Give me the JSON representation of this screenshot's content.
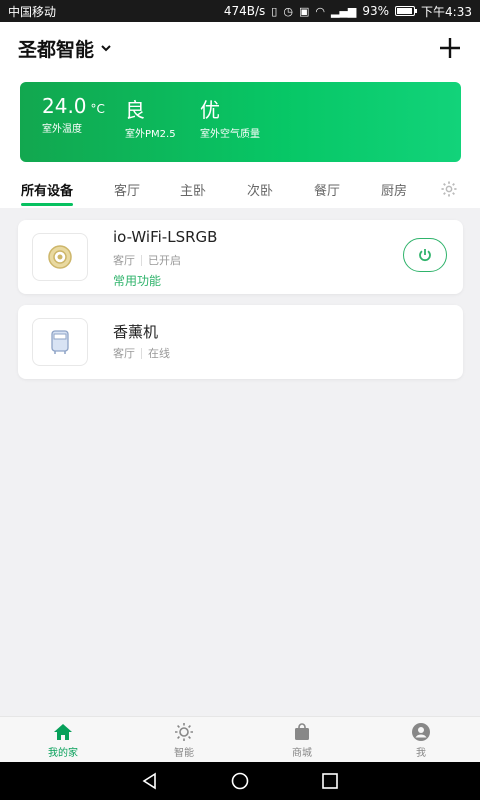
{
  "status_bar": {
    "carrier": "中国移动",
    "speed": "474B/s",
    "battery": "93%",
    "battery_level": 0.93,
    "time": "下午4:33"
  },
  "header": {
    "home_name": "圣都智能",
    "icons": {
      "dropdown": "chevron-down-icon",
      "add": "plus-icon"
    }
  },
  "weather": {
    "temperature": {
      "value": "24.0",
      "unit": "°C",
      "label": "室外温度"
    },
    "pm25": {
      "value": "良",
      "label": "室外PM2.5"
    },
    "air_quality": {
      "value": "优",
      "label": "室外空气质量"
    },
    "colors": {
      "start": "#12a74f",
      "end": "#12d37a"
    }
  },
  "tabs": {
    "items": [
      {
        "label": "所有设备",
        "active": true
      },
      {
        "label": "客厅"
      },
      {
        "label": "主卧"
      },
      {
        "label": "次卧"
      },
      {
        "label": "餐厅"
      },
      {
        "label": "厨房"
      }
    ],
    "settings_icon": "gear-icon"
  },
  "devices": [
    {
      "name": "io-WiFi-LSRGB",
      "room": "客厅",
      "status": "已开启",
      "link": "常用功能",
      "icon": "light-strip-icon",
      "power_icon": "power-icon"
    },
    {
      "name": "香薰机",
      "room": "客厅",
      "status": "在线",
      "icon": "aroma-diffuser-icon"
    }
  ],
  "bottom_nav": {
    "items": [
      {
        "label": "我的家",
        "icon": "home-icon",
        "active": true
      },
      {
        "label": "智能",
        "icon": "sun-icon"
      },
      {
        "label": "商城",
        "icon": "shopping-bag-icon"
      },
      {
        "label": "我",
        "icon": "profile-icon"
      }
    ]
  },
  "system_nav": {
    "icons": [
      "back-icon",
      "home-circle-icon",
      "recents-icon"
    ]
  },
  "colors": {
    "accent": "#07c160",
    "accent_text": "#2fb36b"
  }
}
